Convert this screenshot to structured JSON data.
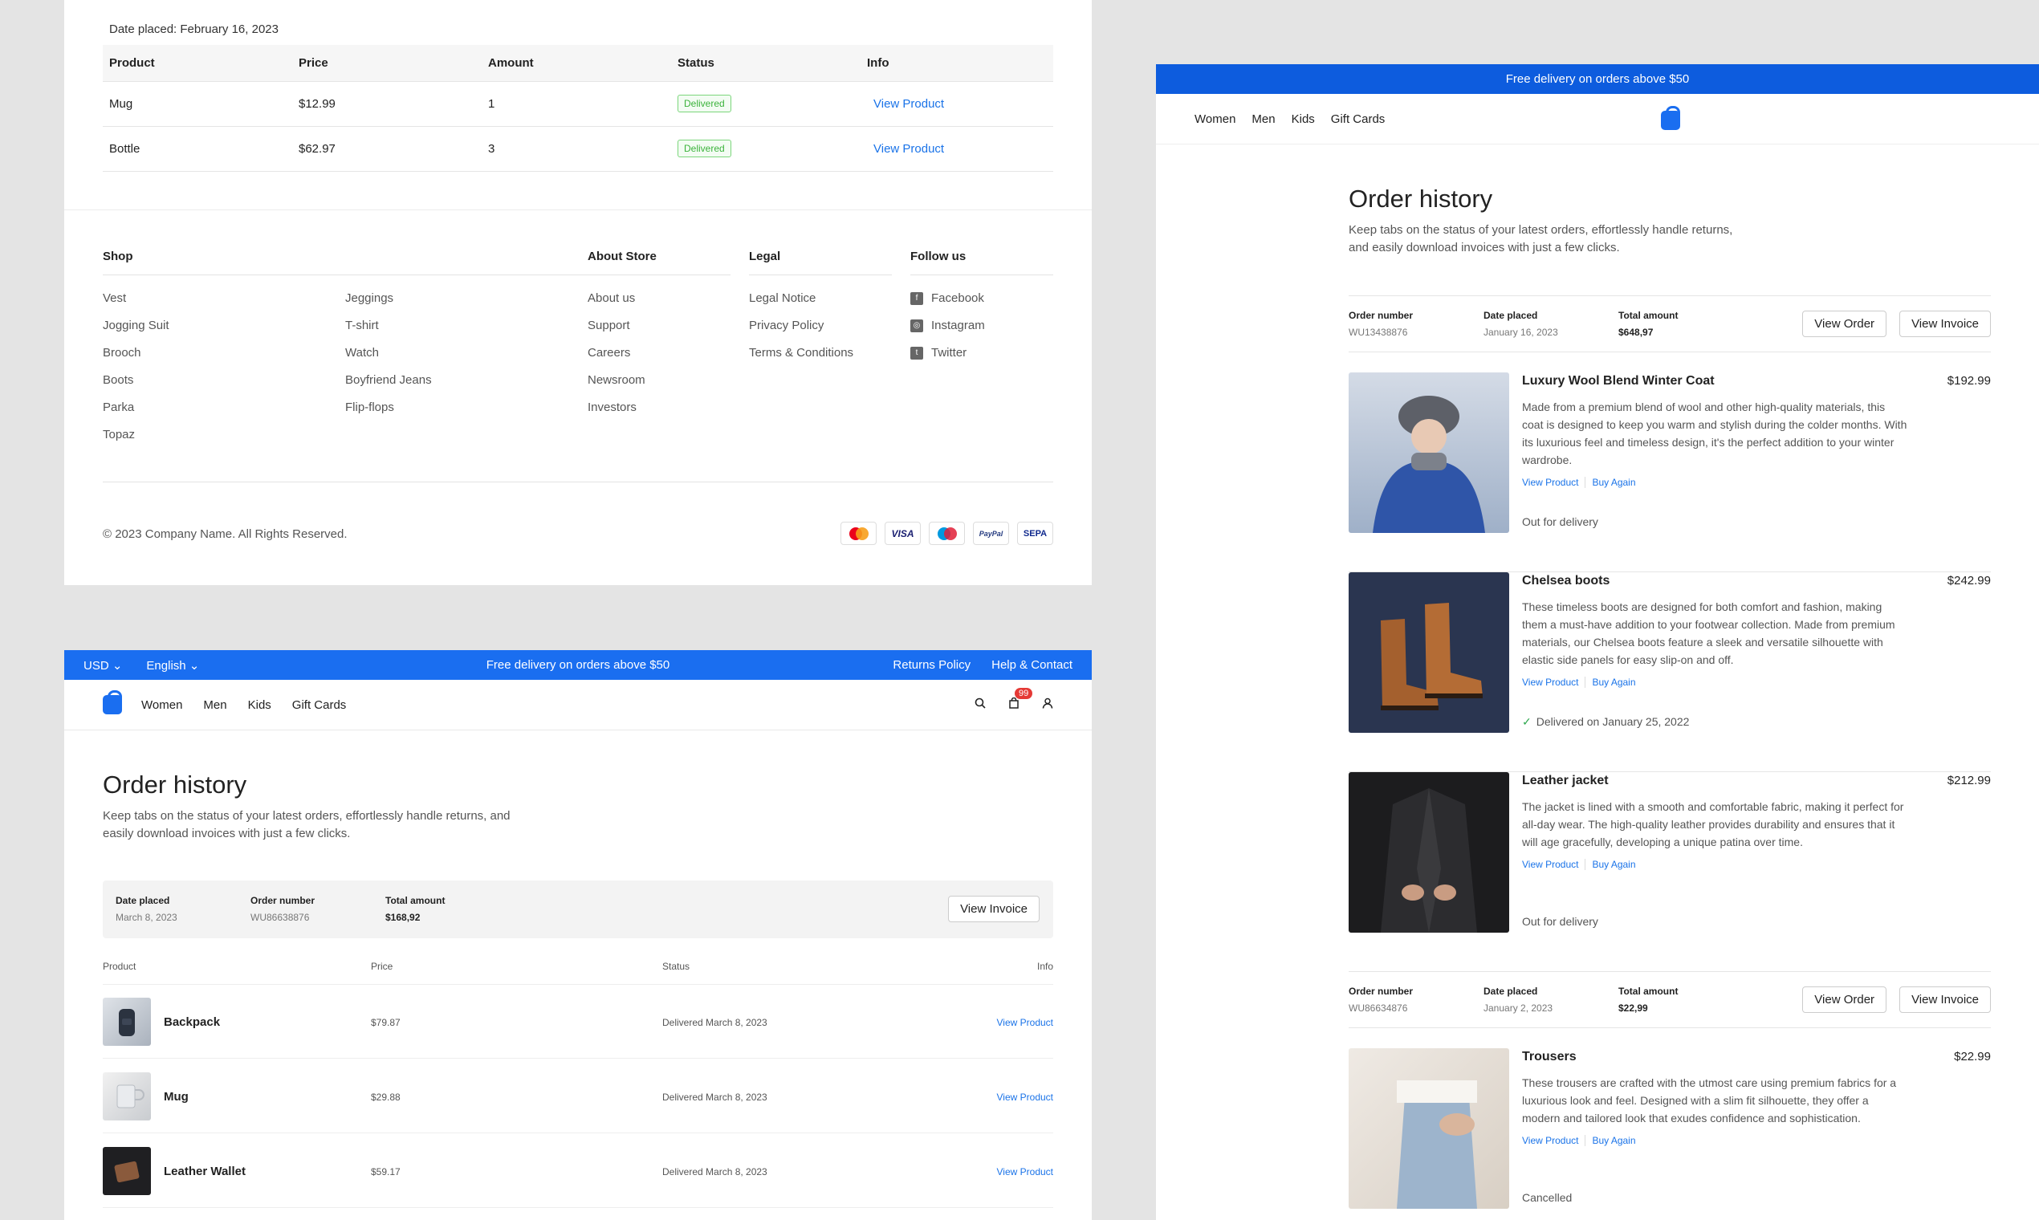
{
  "panel1": {
    "date_placed": "Date placed: February 16, 2023",
    "table_headers": [
      "Product",
      "Price",
      "Amount",
      "Status",
      "Info"
    ],
    "rows": [
      {
        "product": "Mug",
        "price": "$12.99",
        "amount": "1",
        "status": "Delivered",
        "info": "View Product"
      },
      {
        "product": "Bottle",
        "price": "$62.97",
        "amount": "3",
        "status": "Delivered",
        "info": "View Product"
      }
    ],
    "footer": {
      "shop_title": "Shop",
      "shop_col1": [
        "Vest",
        "Jogging Suit",
        "Brooch",
        "Boots",
        "Parka",
        "Topaz"
      ],
      "shop_col2": [
        "Jeggings",
        "T-shirt",
        "Watch",
        "Boyfriend Jeans",
        "Flip-flops"
      ],
      "about_title": "About Store",
      "about": [
        "About us",
        "Support",
        "Careers",
        "Newsroom",
        "Investors"
      ],
      "legal_title": "Legal",
      "legal": [
        "Legal Notice",
        "Privacy Policy",
        "Terms & Conditions"
      ],
      "follow_title": "Follow us",
      "follow": [
        {
          "label": "Facebook",
          "icon": "facebook-icon"
        },
        {
          "label": "Instagram",
          "icon": "instagram-icon"
        },
        {
          "label": "Twitter",
          "icon": "twitter-icon"
        }
      ],
      "copyright": "© 2023 Company Name. All Rights Reserved.",
      "payments": [
        "VISA",
        "PayPal",
        "SEPA"
      ]
    }
  },
  "panel2": {
    "currency": "USD",
    "language": "English",
    "promo": "Free delivery on orders above $50",
    "returns": "Returns Policy",
    "help": "Help & Contact",
    "nav": [
      "Women",
      "Men",
      "Kids",
      "Gift Cards"
    ],
    "cart_count": "99",
    "title": "Order history",
    "subtitle": "Keep tabs on the status of your latest orders, effortlessly handle returns, and easily download invoices with just a few clicks.",
    "order": {
      "date_label": "Date placed",
      "date": "March 8, 2023",
      "num_label": "Order number",
      "num": "WU86638876",
      "total_label": "Total amount",
      "total": "$168,92",
      "invoice": "View Invoice"
    },
    "headers": [
      "Product",
      "Price",
      "Status",
      "Info"
    ],
    "rows": [
      {
        "name": "Backpack",
        "price": "$79.87",
        "status": "Delivered March 8, 2023",
        "info": "View Product"
      },
      {
        "name": "Mug",
        "price": "$29.88",
        "status": "Delivered March 8, 2023",
        "info": "View Product"
      },
      {
        "name": "Leather Wallet",
        "price": "$59.17",
        "status": "Delivered March 8, 2023",
        "info": "View Product"
      }
    ]
  },
  "panel3": {
    "promo": "Free delivery on orders above $50",
    "nav": [
      "Women",
      "Men",
      "Kids",
      "Gift Cards"
    ],
    "title": "Order history",
    "subtitle": "Keep tabs on the status of your latest orders, effortlessly handle returns, and easily download invoices with just a few clicks.",
    "orders": [
      {
        "num_label": "Order number",
        "num": "WU13438876",
        "date_label": "Date placed",
        "date": "January 16, 2023",
        "total_label": "Total amount",
        "total": "$648,97",
        "view_order": "View Order",
        "view_invoice": "View Invoice",
        "items": [
          {
            "name": "Luxury Wool Blend Winter Coat",
            "price": "$192.99",
            "desc": "Made from a premium blend of wool and other high-quality materials, this coat is designed to keep you warm and stylish during the colder months. With its luxurious feel and timeless design, it's the perfect addition to your winter wardrobe.",
            "status": "Out for delivery"
          },
          {
            "name": "Chelsea boots",
            "price": "$242.99",
            "desc": "These timeless boots are designed for both comfort and fashion, making them a must-have addition to your footwear collection. Made from premium materials, our Chelsea boots feature a sleek and versatile silhouette with elastic side panels for easy slip-on and off.",
            "status": "Delivered on January 25, 2022"
          },
          {
            "name": "Leather jacket",
            "price": "$212.99",
            "desc": "The jacket is lined with a smooth and comfortable fabric, making it perfect for all-day wear. The high-quality leather provides durability and ensures that it will age gracefully, developing a unique patina over time.",
            "status": "Out for delivery"
          }
        ]
      },
      {
        "num_label": "Order number",
        "num": "WU86634876",
        "date_label": "Date placed",
        "date": "January 2, 2023",
        "total_label": "Total amount",
        "total": "$22,99",
        "view_order": "View Order",
        "view_invoice": "View Invoice",
        "items": [
          {
            "name": "Trousers",
            "price": "$22.99",
            "desc": "These trousers are crafted with the utmost care using premium fabrics for a luxurious look and feel. Designed with a slim fit silhouette, they offer a modern and tailored look that exudes confidence and sophistication.",
            "status": "Cancelled"
          }
        ]
      }
    ],
    "view_product": "View Product",
    "buy_again": "Buy Again"
  }
}
